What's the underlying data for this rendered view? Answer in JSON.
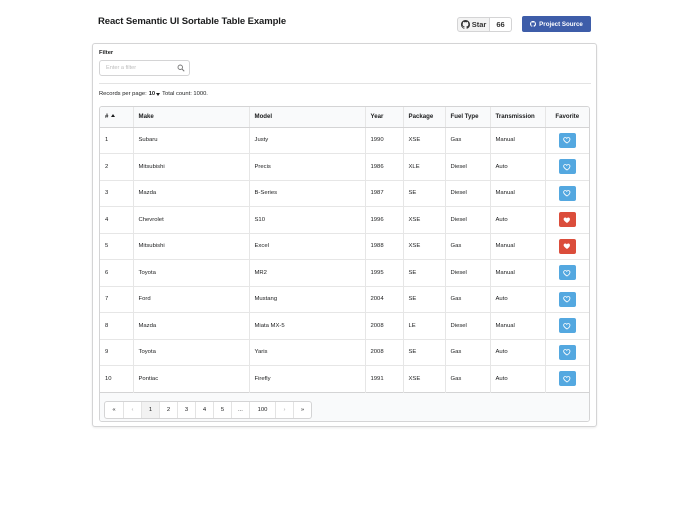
{
  "header": {
    "title": "React Semantic UI Sortable Table Example",
    "star_label": "Star",
    "star_count": "66",
    "project_source_label": "Project Source",
    "github_icon": "github-icon"
  },
  "filter": {
    "label": "Filter",
    "placeholder": "Enter a filter",
    "value": ""
  },
  "records": {
    "label": "Records per page:",
    "per_page": "10",
    "total_label": "Total count: 1000."
  },
  "table": {
    "columns": [
      "#",
      "Make",
      "Model",
      "Year",
      "Package",
      "Fuel Type",
      "Transmission",
      "Favorite"
    ],
    "sorted_column": "#",
    "sort_direction": "ascending",
    "rows": [
      {
        "id": "1",
        "make": "Subaru",
        "model": "Justy",
        "year": "1990",
        "package": "XSE",
        "fuel": "Gas",
        "transmission": "Manual",
        "favorite": false
      },
      {
        "id": "2",
        "make": "Mitsubishi",
        "model": "Precis",
        "year": "1986",
        "package": "XLE",
        "fuel": "Diesel",
        "transmission": "Auto",
        "favorite": false
      },
      {
        "id": "3",
        "make": "Mazda",
        "model": "B-Series",
        "year": "1987",
        "package": "SE",
        "fuel": "Diesel",
        "transmission": "Manual",
        "favorite": false
      },
      {
        "id": "4",
        "make": "Chevrolet",
        "model": "S10",
        "year": "1996",
        "package": "XSE",
        "fuel": "Diesel",
        "transmission": "Auto",
        "favorite": true
      },
      {
        "id": "5",
        "make": "Mitsubishi",
        "model": "Excel",
        "year": "1988",
        "package": "XSE",
        "fuel": "Gas",
        "transmission": "Manual",
        "favorite": true
      },
      {
        "id": "6",
        "make": "Toyota",
        "model": "MR2",
        "year": "1995",
        "package": "SE",
        "fuel": "Diesel",
        "transmission": "Manual",
        "favorite": false
      },
      {
        "id": "7",
        "make": "Ford",
        "model": "Mustang",
        "year": "2004",
        "package": "SE",
        "fuel": "Gas",
        "transmission": "Auto",
        "favorite": false
      },
      {
        "id": "8",
        "make": "Mazda",
        "model": "Miata MX-5",
        "year": "2008",
        "package": "LE",
        "fuel": "Diesel",
        "transmission": "Manual",
        "favorite": false
      },
      {
        "id": "9",
        "make": "Toyota",
        "model": "Yaris",
        "year": "2008",
        "package": "SE",
        "fuel": "Gas",
        "transmission": "Auto",
        "favorite": false
      },
      {
        "id": "10",
        "make": "Pontiac",
        "model": "Firefly",
        "year": "1991",
        "package": "XSE",
        "fuel": "Gas",
        "transmission": "Auto",
        "favorite": false
      }
    ]
  },
  "pagination": {
    "first": "«",
    "prev": "‹",
    "pages": [
      "1",
      "2",
      "3",
      "4",
      "5"
    ],
    "active_page": "1",
    "ellipsis": "...",
    "last_page": "100",
    "next": "›",
    "last": "»"
  },
  "colors": {
    "primary_button": "#3e5da9",
    "favorite_off": "#54a8e0",
    "favorite_on": "#db4d3b"
  }
}
